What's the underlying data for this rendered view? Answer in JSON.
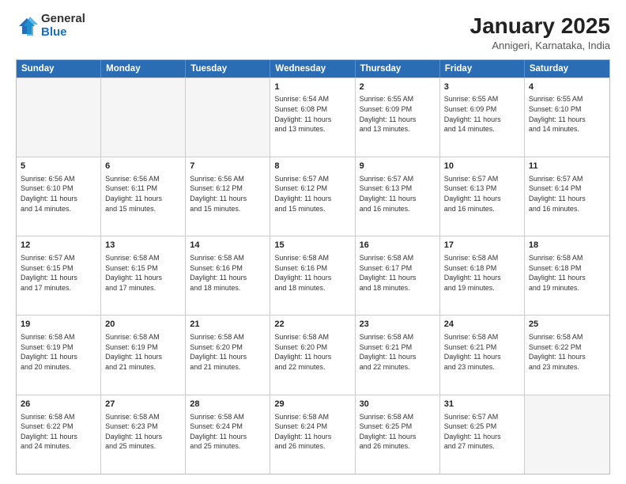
{
  "logo": {
    "general": "General",
    "blue": "Blue"
  },
  "title": "January 2025",
  "subtitle": "Annigeri, Karnataka, India",
  "days_of_week": [
    "Sunday",
    "Monday",
    "Tuesday",
    "Wednesday",
    "Thursday",
    "Friday",
    "Saturday"
  ],
  "weeks": [
    [
      {
        "day": "",
        "info": ""
      },
      {
        "day": "",
        "info": ""
      },
      {
        "day": "",
        "info": ""
      },
      {
        "day": "1",
        "info": "Sunrise: 6:54 AM\nSunset: 6:08 PM\nDaylight: 11 hours\nand 13 minutes."
      },
      {
        "day": "2",
        "info": "Sunrise: 6:55 AM\nSunset: 6:09 PM\nDaylight: 11 hours\nand 13 minutes."
      },
      {
        "day": "3",
        "info": "Sunrise: 6:55 AM\nSunset: 6:09 PM\nDaylight: 11 hours\nand 14 minutes."
      },
      {
        "day": "4",
        "info": "Sunrise: 6:55 AM\nSunset: 6:10 PM\nDaylight: 11 hours\nand 14 minutes."
      }
    ],
    [
      {
        "day": "5",
        "info": "Sunrise: 6:56 AM\nSunset: 6:10 PM\nDaylight: 11 hours\nand 14 minutes."
      },
      {
        "day": "6",
        "info": "Sunrise: 6:56 AM\nSunset: 6:11 PM\nDaylight: 11 hours\nand 15 minutes."
      },
      {
        "day": "7",
        "info": "Sunrise: 6:56 AM\nSunset: 6:12 PM\nDaylight: 11 hours\nand 15 minutes."
      },
      {
        "day": "8",
        "info": "Sunrise: 6:57 AM\nSunset: 6:12 PM\nDaylight: 11 hours\nand 15 minutes."
      },
      {
        "day": "9",
        "info": "Sunrise: 6:57 AM\nSunset: 6:13 PM\nDaylight: 11 hours\nand 16 minutes."
      },
      {
        "day": "10",
        "info": "Sunrise: 6:57 AM\nSunset: 6:13 PM\nDaylight: 11 hours\nand 16 minutes."
      },
      {
        "day": "11",
        "info": "Sunrise: 6:57 AM\nSunset: 6:14 PM\nDaylight: 11 hours\nand 16 minutes."
      }
    ],
    [
      {
        "day": "12",
        "info": "Sunrise: 6:57 AM\nSunset: 6:15 PM\nDaylight: 11 hours\nand 17 minutes."
      },
      {
        "day": "13",
        "info": "Sunrise: 6:58 AM\nSunset: 6:15 PM\nDaylight: 11 hours\nand 17 minutes."
      },
      {
        "day": "14",
        "info": "Sunrise: 6:58 AM\nSunset: 6:16 PM\nDaylight: 11 hours\nand 18 minutes."
      },
      {
        "day": "15",
        "info": "Sunrise: 6:58 AM\nSunset: 6:16 PM\nDaylight: 11 hours\nand 18 minutes."
      },
      {
        "day": "16",
        "info": "Sunrise: 6:58 AM\nSunset: 6:17 PM\nDaylight: 11 hours\nand 18 minutes."
      },
      {
        "day": "17",
        "info": "Sunrise: 6:58 AM\nSunset: 6:18 PM\nDaylight: 11 hours\nand 19 minutes."
      },
      {
        "day": "18",
        "info": "Sunrise: 6:58 AM\nSunset: 6:18 PM\nDaylight: 11 hours\nand 19 minutes."
      }
    ],
    [
      {
        "day": "19",
        "info": "Sunrise: 6:58 AM\nSunset: 6:19 PM\nDaylight: 11 hours\nand 20 minutes."
      },
      {
        "day": "20",
        "info": "Sunrise: 6:58 AM\nSunset: 6:19 PM\nDaylight: 11 hours\nand 21 minutes."
      },
      {
        "day": "21",
        "info": "Sunrise: 6:58 AM\nSunset: 6:20 PM\nDaylight: 11 hours\nand 21 minutes."
      },
      {
        "day": "22",
        "info": "Sunrise: 6:58 AM\nSunset: 6:20 PM\nDaylight: 11 hours\nand 22 minutes."
      },
      {
        "day": "23",
        "info": "Sunrise: 6:58 AM\nSunset: 6:21 PM\nDaylight: 11 hours\nand 22 minutes."
      },
      {
        "day": "24",
        "info": "Sunrise: 6:58 AM\nSunset: 6:21 PM\nDaylight: 11 hours\nand 23 minutes."
      },
      {
        "day": "25",
        "info": "Sunrise: 6:58 AM\nSunset: 6:22 PM\nDaylight: 11 hours\nand 23 minutes."
      }
    ],
    [
      {
        "day": "26",
        "info": "Sunrise: 6:58 AM\nSunset: 6:22 PM\nDaylight: 11 hours\nand 24 minutes."
      },
      {
        "day": "27",
        "info": "Sunrise: 6:58 AM\nSunset: 6:23 PM\nDaylight: 11 hours\nand 25 minutes."
      },
      {
        "day": "28",
        "info": "Sunrise: 6:58 AM\nSunset: 6:24 PM\nDaylight: 11 hours\nand 25 minutes."
      },
      {
        "day": "29",
        "info": "Sunrise: 6:58 AM\nSunset: 6:24 PM\nDaylight: 11 hours\nand 26 minutes."
      },
      {
        "day": "30",
        "info": "Sunrise: 6:58 AM\nSunset: 6:25 PM\nDaylight: 11 hours\nand 26 minutes."
      },
      {
        "day": "31",
        "info": "Sunrise: 6:57 AM\nSunset: 6:25 PM\nDaylight: 11 hours\nand 27 minutes."
      },
      {
        "day": "",
        "info": ""
      }
    ]
  ]
}
